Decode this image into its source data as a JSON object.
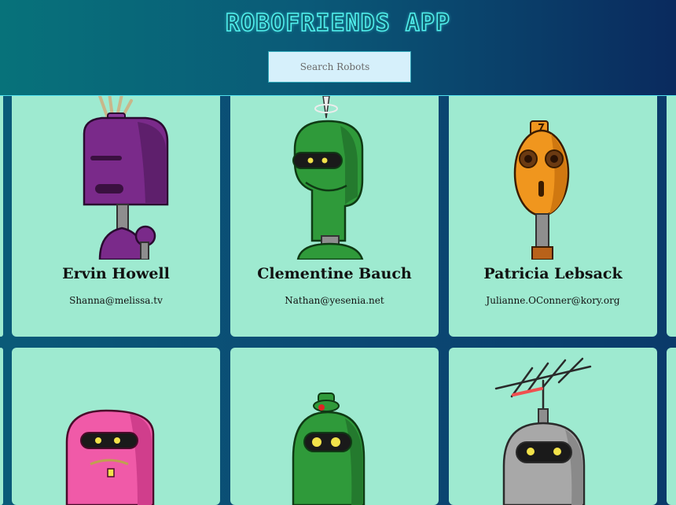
{
  "header": {
    "title": "ROBOFRIENDS APP",
    "search_placeholder": "Search Robots"
  },
  "robots": [
    {
      "name": "Ervin Howell",
      "email": "Shanna@melissa.tv",
      "color": "#7a2a8a"
    },
    {
      "name": "Clementine Bauch",
      "email": "Nathan@yesenia.net",
      "color": "#2f9a3a"
    },
    {
      "name": "Patricia Lebsack",
      "email": "Julianne.OConner@kory.org",
      "color": "#f0961e"
    },
    {
      "name": "",
      "email": "",
      "color": "#f05aa8"
    },
    {
      "name": "",
      "email": "",
      "color": "#2f9a3a"
    },
    {
      "name": "",
      "email": "",
      "color": "#a8a8a8"
    }
  ],
  "colors": {
    "card_bg": "#9eead0",
    "title_glow": "#52f2ef",
    "page_bg": "#0b4a74"
  }
}
